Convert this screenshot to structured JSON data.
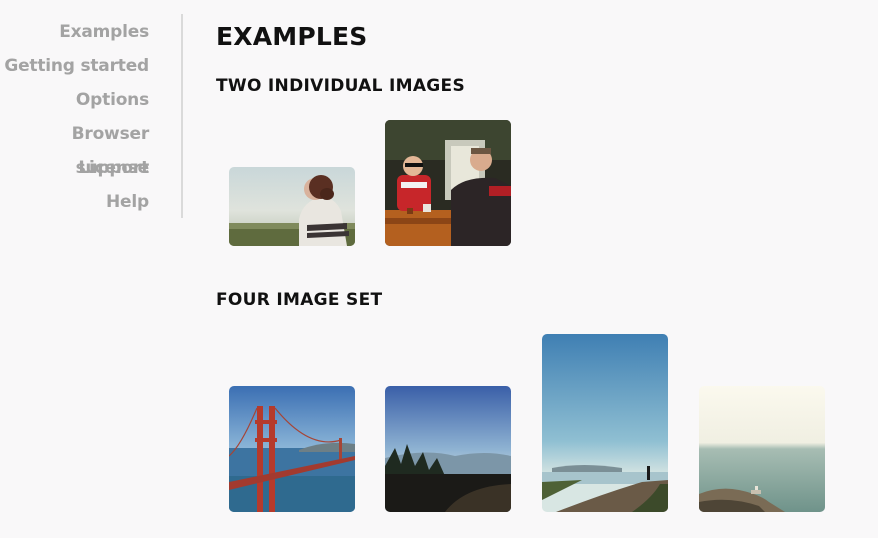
{
  "sidebar": {
    "items": [
      {
        "label": "Examples"
      },
      {
        "label": "Getting started"
      },
      {
        "label": "Options"
      },
      {
        "label": "Browser support"
      },
      {
        "label": "License"
      },
      {
        "label": "Help"
      }
    ]
  },
  "main": {
    "title": "EXAMPLES",
    "sections": [
      {
        "heading": "TWO INDIVIDUAL IMAGES"
      },
      {
        "heading": "FOUR IMAGE SET"
      }
    ]
  },
  "colors": {
    "sidebar_link": "#a3a3a3",
    "heading": "#111111",
    "background": "#f9f8f9",
    "divider": "#dadada"
  }
}
